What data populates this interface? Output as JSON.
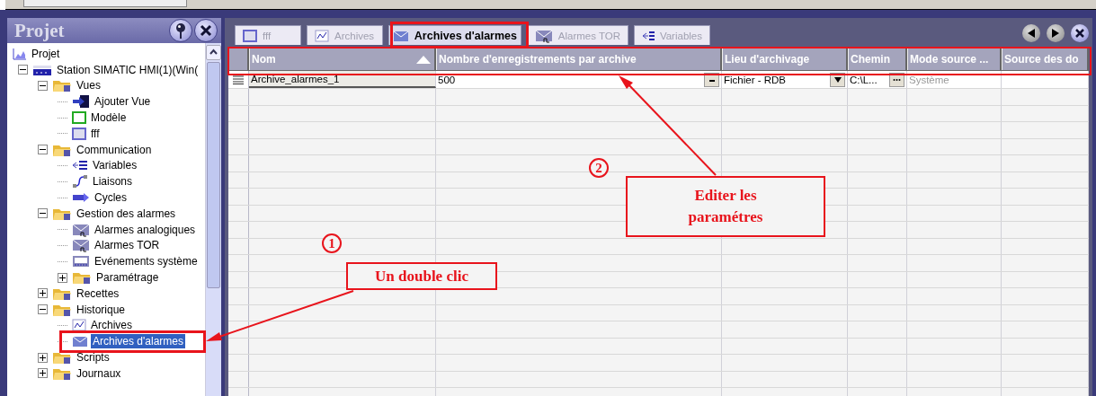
{
  "project_panel": {
    "title": "Projet",
    "tree": [
      {
        "label": "Projet",
        "kind": "project",
        "selected": false,
        "children": [
          {
            "label": "Station SIMATIC HMI(1)(Win(",
            "kind": "station",
            "expanded": true,
            "selected": false,
            "children": [
              {
                "label": "Vues",
                "kind": "folder",
                "expanded": true,
                "selected": false,
                "children": [
                  {
                    "label": "Ajouter Vue",
                    "kind": "add",
                    "selected": false
                  },
                  {
                    "label": "Modèle",
                    "kind": "template",
                    "selected": false
                  },
                  {
                    "label": "fff",
                    "kind": "screen",
                    "selected": false
                  }
                ]
              },
              {
                "label": "Communication",
                "kind": "folder",
                "expanded": true,
                "selected": false,
                "children": [
                  {
                    "label": "Variables",
                    "kind": "variables",
                    "selected": false
                  },
                  {
                    "label": "Liaisons",
                    "kind": "links",
                    "selected": false
                  },
                  {
                    "label": "Cycles",
                    "kind": "cycles",
                    "selected": false
                  }
                ]
              },
              {
                "label": "Gestion des alarmes",
                "kind": "folder",
                "expanded": true,
                "selected": false,
                "children": [
                  {
                    "label": "Alarmes analogiques",
                    "kind": "alarm",
                    "selected": false
                  },
                  {
                    "label": "Alarmes TOR",
                    "kind": "alarm",
                    "selected": false
                  },
                  {
                    "label": "Evénements système",
                    "kind": "events",
                    "selected": false
                  },
                  {
                    "label": "Paramétrage",
                    "kind": "folder",
                    "expanded": false,
                    "selected": false
                  }
                ]
              },
              {
                "label": "Recettes",
                "kind": "folder",
                "expanded": false,
                "selected": false
              },
              {
                "label": "Historique",
                "kind": "folder",
                "expanded": true,
                "selected": false,
                "children": [
                  {
                    "label": "Archives",
                    "kind": "archive",
                    "selected": false
                  },
                  {
                    "label": "Archives d'alarmes",
                    "kind": "alarm-archive",
                    "selected": true
                  }
                ]
              },
              {
                "label": "Scripts",
                "kind": "folder",
                "expanded": false,
                "selected": false
              },
              {
                "label": "Journaux",
                "kind": "folder",
                "expanded": false,
                "selected": false
              }
            ]
          }
        ]
      }
    ]
  },
  "editor": {
    "tabs": [
      {
        "label": "fff",
        "kind": "screen",
        "selected": false
      },
      {
        "label": "Archives",
        "kind": "archive",
        "selected": false
      },
      {
        "label": "Archives d'alarmes",
        "kind": "alarm-archive",
        "selected": true
      },
      {
        "label": "Alarmes TOR",
        "kind": "alarm",
        "selected": false
      },
      {
        "label": "Variables",
        "kind": "variables",
        "selected": false
      }
    ],
    "table": {
      "columns": [
        {
          "label": "Nom",
          "sorted": true
        },
        {
          "label": "Nombre d'enregistrements par archive",
          "sorted": false
        },
        {
          "label": "Lieu d'archivage",
          "sorted": false
        },
        {
          "label": "Chemin",
          "sorted": false
        },
        {
          "label": "Mode source ...",
          "sorted": false
        },
        {
          "label": "Source des do",
          "sorted": false
        }
      ],
      "rows": [
        {
          "cells": [
            {
              "text": "Archive_alarmes_1",
              "kind": "name"
            },
            {
              "text": "500",
              "kind": "spin"
            },
            {
              "text": "Fichier - RDB",
              "kind": "dropdown"
            },
            {
              "text": "C:\\L...",
              "kind": "browse"
            },
            {
              "text": "Système",
              "kind": "disabled"
            },
            {
              "text": "",
              "kind": "plain"
            }
          ]
        }
      ]
    }
  },
  "annotations": [
    {
      "number": "1",
      "text": "Un double clic"
    },
    {
      "number": "2",
      "text": "Editer les paramétres"
    }
  ]
}
